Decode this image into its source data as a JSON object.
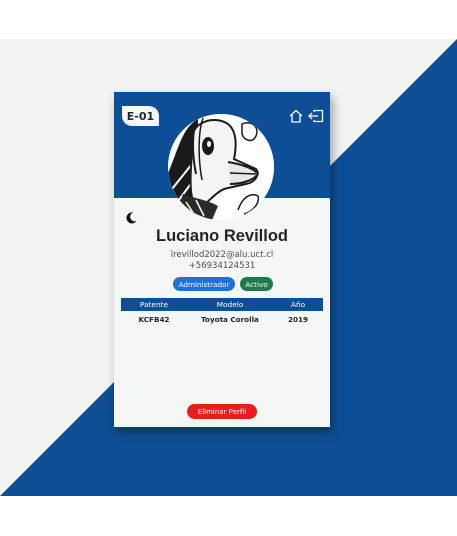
{
  "colors": {
    "primary": "#0d4f96",
    "background": "#f2f3f3",
    "danger": "#ea1d1d",
    "role_badge": "#1e71d9",
    "status_badge": "#1e7a4a"
  },
  "card": {
    "code": "E-01",
    "icons": {
      "home": "home-icon",
      "logout": "logout-icon",
      "theme": "moon-icon",
      "avatar": "avatar-illustration"
    }
  },
  "profile": {
    "name": "Luciano Revillod",
    "email": "lrevillod2022@alu.uct.cl",
    "phone": "+56934124531",
    "role": "Administrador",
    "status": "Activo"
  },
  "vehicles": {
    "headers": {
      "plate": "Patente",
      "model": "Modelo",
      "year": "Año"
    },
    "rows": [
      {
        "plate": "KCFB42",
        "model": "Toyota Corolla",
        "year": "2019"
      }
    ]
  },
  "actions": {
    "delete_label": "Eliminar Perfil"
  }
}
